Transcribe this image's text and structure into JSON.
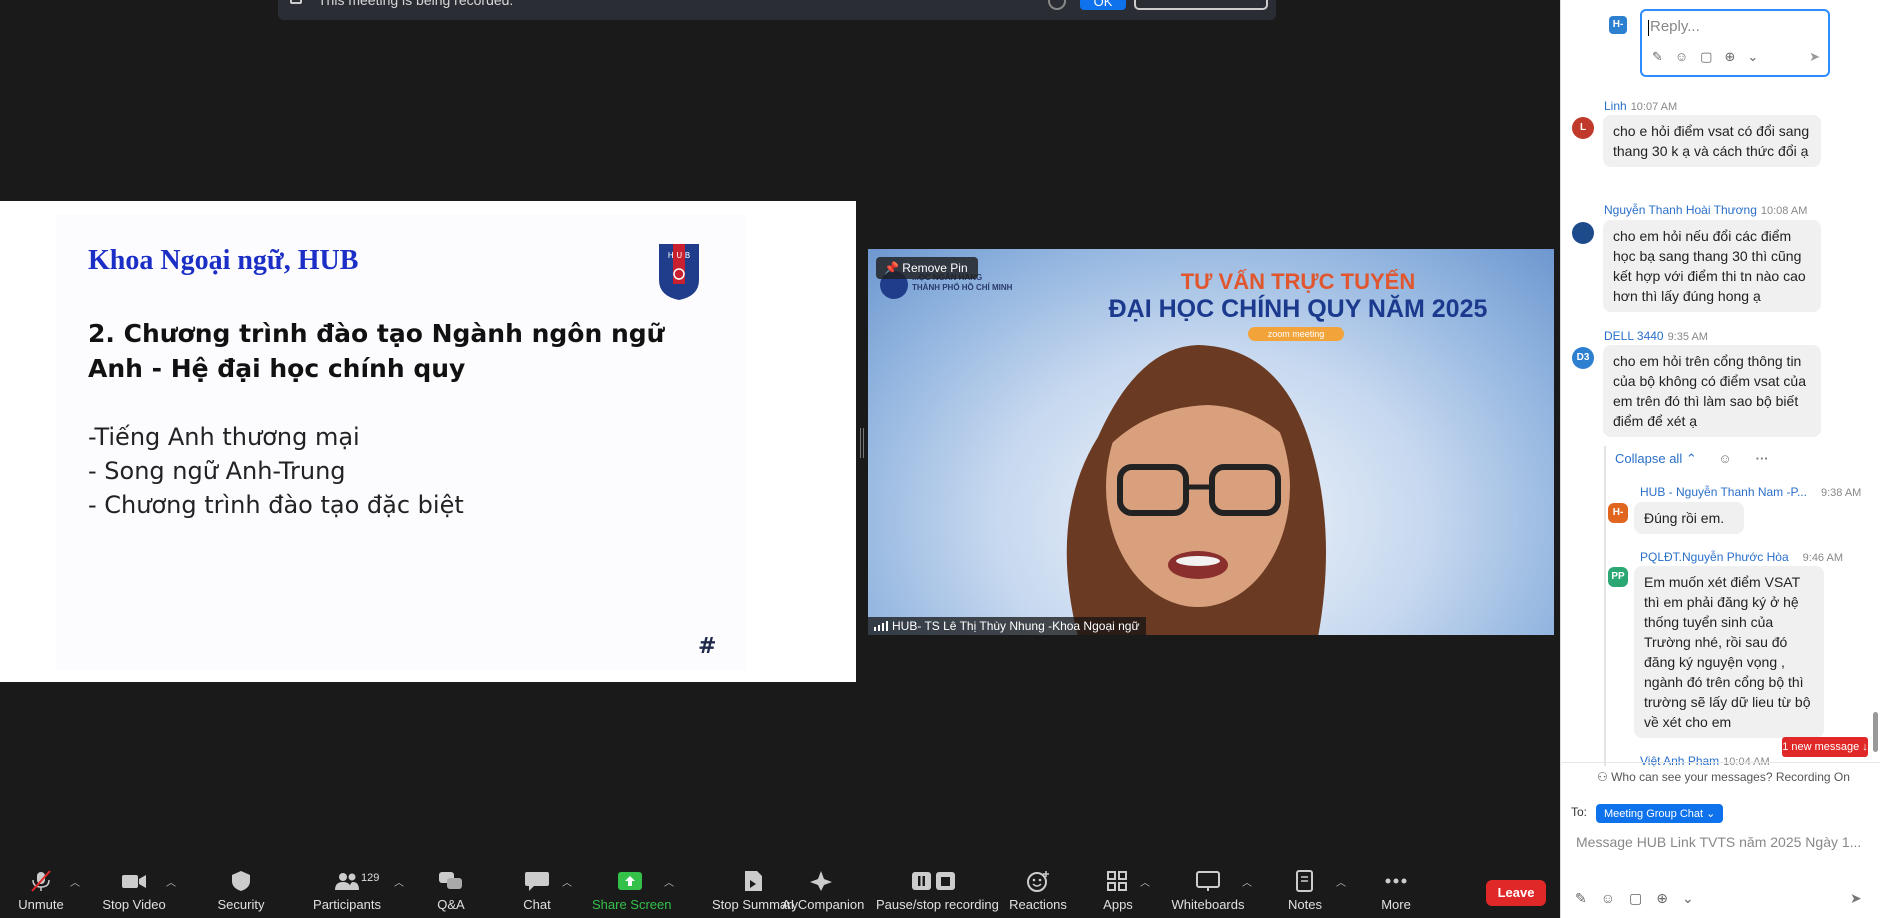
{
  "banner": {
    "text": "This meeting is being recorded.",
    "ok_label": "OK",
    "colors": {
      "accent": "#0e72ed"
    }
  },
  "slide": {
    "title": "Khoa Ngoại ngữ, HUB",
    "heading": "2. Chương trình đào tạo Ngành ngôn ngữ Anh - Hệ đại học chính quy",
    "bullets": [
      "-Tiếng Anh thương mại",
      "- Song ngữ Anh-Trung",
      "- Chương trình đào tạo đặc biệt"
    ],
    "footer": "#",
    "logo_text": "HUB"
  },
  "video": {
    "remove_pin_label": "Remove Pin",
    "participant_name": "HUB- TS Lê Thị Thùy Nhung -Khoa Ngoại ngữ",
    "banner_line1": "TƯ VẤN TRỰC TUYẾN",
    "banner_line2": "ĐẠI HỌC CHÍNH QUY NĂM 2025",
    "banner_tag": "zoom meeting",
    "logo_caption": "...ỌC NGÂN HÀNG\nTHÀNH PHỐ HỒ CHÍ MINH"
  },
  "toolbar": {
    "unmute": "Unmute",
    "stop_video": "Stop Video",
    "security": "Security",
    "participants": "Participants",
    "participants_count": "129",
    "qa": "Q&A",
    "chat": "Chat",
    "share_screen": "Share Screen",
    "stop_summary": "Stop Summary",
    "ai_companion": "AI Companion",
    "pause_recording": "Pause/stop recording",
    "reactions": "Reactions",
    "apps": "Apps",
    "whiteboards": "Whiteboards",
    "notes": "Notes",
    "more": "More",
    "leave": "Leave"
  },
  "chat": {
    "reply_avatar": "H-",
    "reply_placeholder": "Reply...",
    "messages": [
      {
        "avatar": "L",
        "avatar_color": "#c0392b",
        "name": "Linh",
        "time": "10:07 AM",
        "text": "cho e hỏi điểm vsat có đổi sang thang 30 k ạ và cách thức đổi ạ"
      },
      {
        "avatar": "",
        "avatar_color": "#1c4a8a",
        "name": "Nguyễn Thanh Hoài Thương",
        "time": "10:08 AM",
        "text": "cho em hỏi nếu đổi các điểm học bạ sang thang 30 thì cũng kết hợp với điểm thi tn nào cao hơn thì lấy đúng hong ạ"
      },
      {
        "avatar": "D3",
        "avatar_color": "#2d7fd0",
        "name": "DELL 3440",
        "time": "9:35 AM",
        "text": "cho em hỏi trên cổng thông tin của bộ không có điểm vsat của em trên đó thì làm sao bộ biết điểm để xét ạ"
      }
    ],
    "collapse_label": "Collapse all",
    "replies": [
      {
        "avatar": "H-",
        "avatar_color": "#e0661f",
        "name": "HUB - Nguyễn Thanh Nam -P...",
        "time": "9:38 AM",
        "text": "Đúng rồi em."
      },
      {
        "avatar": "PP",
        "avatar_color": "#2aa772",
        "name": "PQLĐT.Nguyễn Phước Hòa",
        "time": "9:46 AM",
        "text": "Em muốn xét điểm VSAT thì em phải đăng ký ở hệ thống tuyển sinh của Trường nhé, rồi sau đó đăng ký nguyện vọng , ngành  đó trên cổng bộ thì trường sẽ lấy dữ lieu từ bộ về xét cho em"
      },
      {
        "avatar": "",
        "avatar_color": "#888888",
        "name": "Việt Anh Pham",
        "time": "10:04 AM",
        "text": ""
      }
    ],
    "new_message_label": "1 new message",
    "privacy_text": "Who can see your messages? Recording On",
    "to_label": "To:",
    "to_value": "Meeting Group Chat",
    "input_placeholder": "Message HUB Link TVTS năm 2025 Ngày 1..."
  }
}
